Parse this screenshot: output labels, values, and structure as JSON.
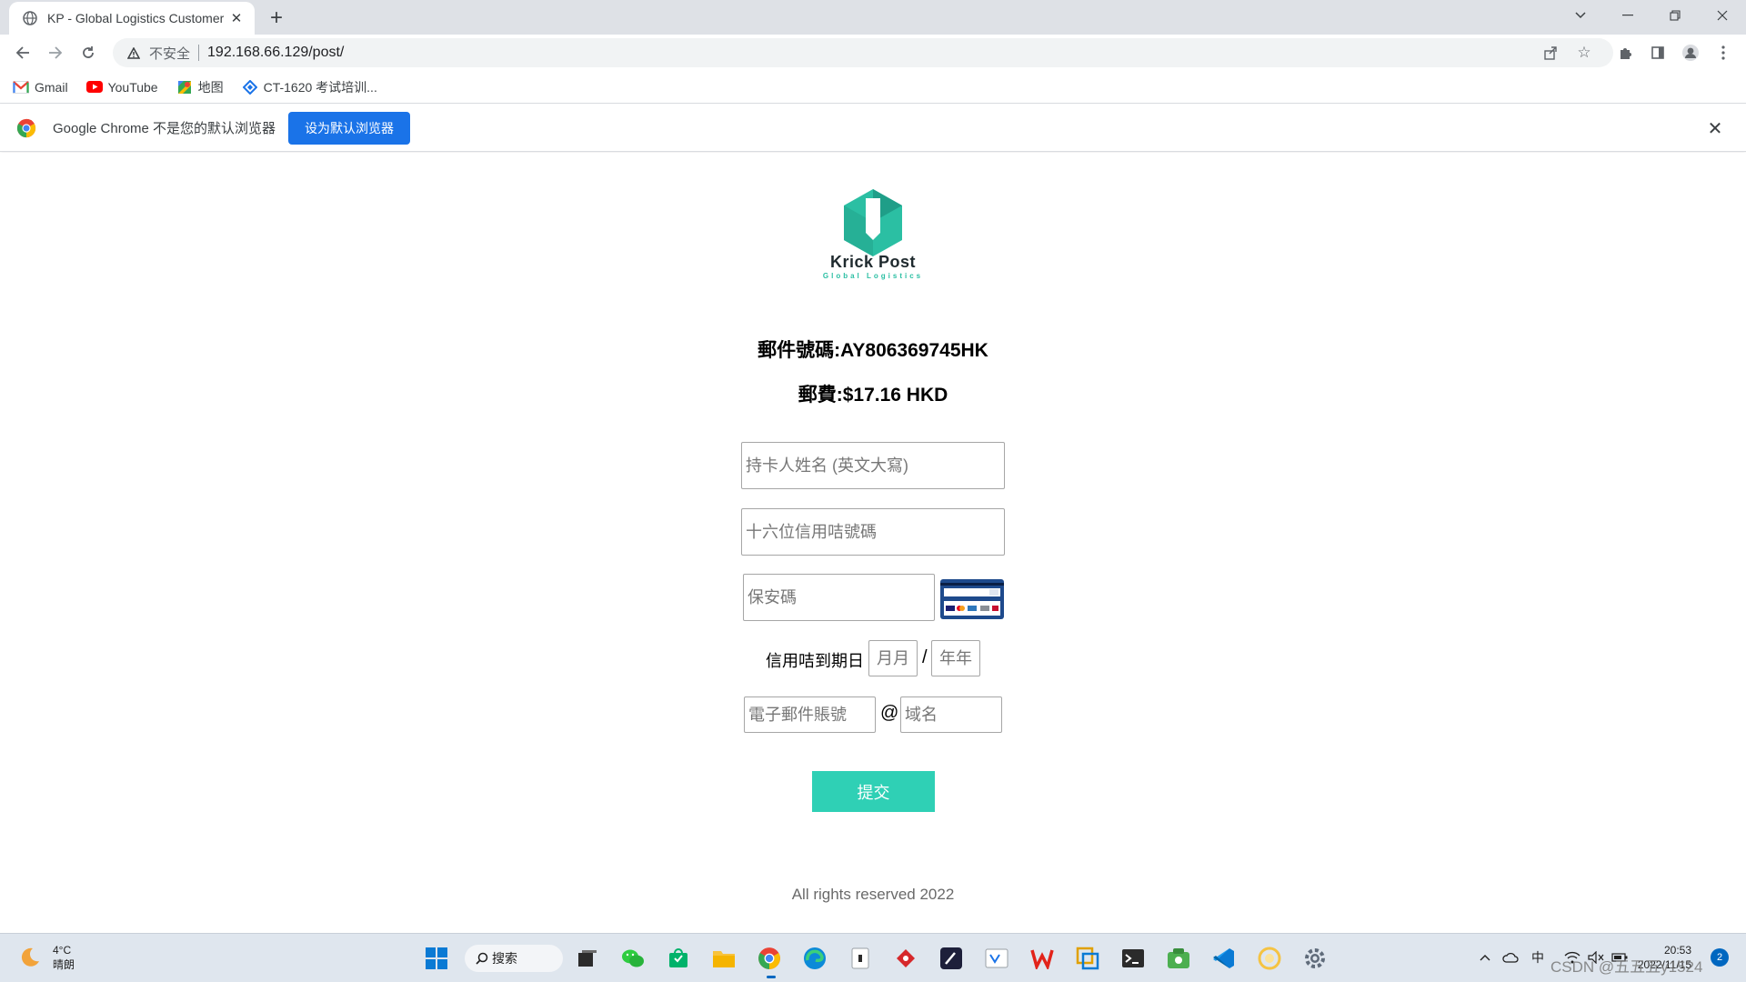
{
  "browser": {
    "tab_title": "KP - Global Logistics Customer",
    "new_tab_symbol": "+",
    "insecure_label": "不安全",
    "url": "192.168.66.129/post/"
  },
  "bookmarks": [
    {
      "label": "Gmail",
      "icon": "gmail-icon"
    },
    {
      "label": "YouTube",
      "icon": "youtube-icon"
    },
    {
      "label": "地图",
      "icon": "maps-icon"
    },
    {
      "label": "CT-1620 考试培训...",
      "icon": "diamond-icon"
    }
  ],
  "infobar": {
    "message": "Google Chrome 不是您的默认浏览器",
    "button": "设为默认浏览器"
  },
  "page": {
    "brand_name": "Krick Post",
    "brand_sub": "Global Logistics",
    "tracking": "郵件號碼:AY806369745HK",
    "fee": "郵費:$17.16 HKD",
    "form": {
      "cardholder_placeholder": "持卡人姓名 (英文大寫)",
      "card_number_placeholder": "十六位信用咭號碼",
      "cvv_placeholder": "保安碼",
      "expiry_label": "信用咭到期日",
      "month_placeholder": "月月",
      "expiry_sep": "/",
      "year_placeholder": "年年",
      "email_placeholder": "電子郵件賬號",
      "at_sign": "@",
      "domain_placeholder": "域名",
      "submit": "提交"
    },
    "footer": "All rights reserved 2022"
  },
  "taskbar": {
    "weather_temp": "4°C",
    "weather_desc": "晴朗",
    "search_label": "搜索",
    "ime": "中",
    "time": "20:53",
    "date": "2022/11/15",
    "watermark": "CSDN @五五五y1524",
    "notif_count": "2"
  },
  "colors": {
    "accent_button": "#2fd0b5",
    "chrome_blue": "#1a73e8",
    "brand_teal": "#2bbfa3"
  }
}
